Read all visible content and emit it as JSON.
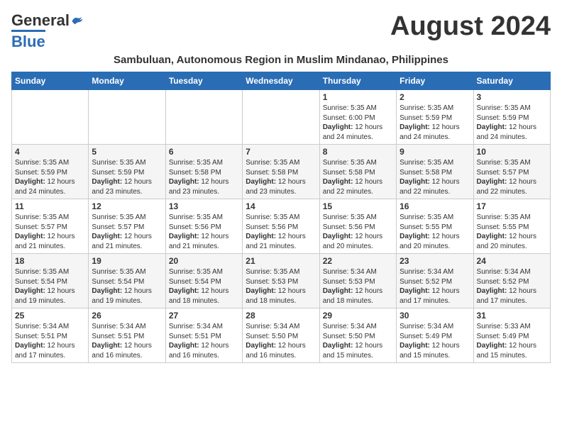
{
  "logo": {
    "general": "General",
    "blue": "Blue"
  },
  "month_year": "August 2024",
  "subtitle": "Sambuluan, Autonomous Region in Muslim Mindanao, Philippines",
  "days_of_week": [
    "Sunday",
    "Monday",
    "Tuesday",
    "Wednesday",
    "Thursday",
    "Friday",
    "Saturday"
  ],
  "weeks": [
    [
      {
        "day": "",
        "sunrise": "",
        "sunset": "",
        "daylight": ""
      },
      {
        "day": "",
        "sunrise": "",
        "sunset": "",
        "daylight": ""
      },
      {
        "day": "",
        "sunrise": "",
        "sunset": "",
        "daylight": ""
      },
      {
        "day": "",
        "sunrise": "",
        "sunset": "",
        "daylight": ""
      },
      {
        "day": "1",
        "sunrise": "Sunrise: 5:35 AM",
        "sunset": "Sunset: 6:00 PM",
        "daylight": "Daylight: 12 hours and 24 minutes."
      },
      {
        "day": "2",
        "sunrise": "Sunrise: 5:35 AM",
        "sunset": "Sunset: 5:59 PM",
        "daylight": "Daylight: 12 hours and 24 minutes."
      },
      {
        "day": "3",
        "sunrise": "Sunrise: 5:35 AM",
        "sunset": "Sunset: 5:59 PM",
        "daylight": "Daylight: 12 hours and 24 minutes."
      }
    ],
    [
      {
        "day": "4",
        "sunrise": "Sunrise: 5:35 AM",
        "sunset": "Sunset: 5:59 PM",
        "daylight": "Daylight: 12 hours and 24 minutes."
      },
      {
        "day": "5",
        "sunrise": "Sunrise: 5:35 AM",
        "sunset": "Sunset: 5:59 PM",
        "daylight": "Daylight: 12 hours and 23 minutes."
      },
      {
        "day": "6",
        "sunrise": "Sunrise: 5:35 AM",
        "sunset": "Sunset: 5:58 PM",
        "daylight": "Daylight: 12 hours and 23 minutes."
      },
      {
        "day": "7",
        "sunrise": "Sunrise: 5:35 AM",
        "sunset": "Sunset: 5:58 PM",
        "daylight": "Daylight: 12 hours and 23 minutes."
      },
      {
        "day": "8",
        "sunrise": "Sunrise: 5:35 AM",
        "sunset": "Sunset: 5:58 PM",
        "daylight": "Daylight: 12 hours and 22 minutes."
      },
      {
        "day": "9",
        "sunrise": "Sunrise: 5:35 AM",
        "sunset": "Sunset: 5:58 PM",
        "daylight": "Daylight: 12 hours and 22 minutes."
      },
      {
        "day": "10",
        "sunrise": "Sunrise: 5:35 AM",
        "sunset": "Sunset: 5:57 PM",
        "daylight": "Daylight: 12 hours and 22 minutes."
      }
    ],
    [
      {
        "day": "11",
        "sunrise": "Sunrise: 5:35 AM",
        "sunset": "Sunset: 5:57 PM",
        "daylight": "Daylight: 12 hours and 21 minutes."
      },
      {
        "day": "12",
        "sunrise": "Sunrise: 5:35 AM",
        "sunset": "Sunset: 5:57 PM",
        "daylight": "Daylight: 12 hours and 21 minutes."
      },
      {
        "day": "13",
        "sunrise": "Sunrise: 5:35 AM",
        "sunset": "Sunset: 5:56 PM",
        "daylight": "Daylight: 12 hours and 21 minutes."
      },
      {
        "day": "14",
        "sunrise": "Sunrise: 5:35 AM",
        "sunset": "Sunset: 5:56 PM",
        "daylight": "Daylight: 12 hours and 21 minutes."
      },
      {
        "day": "15",
        "sunrise": "Sunrise: 5:35 AM",
        "sunset": "Sunset: 5:56 PM",
        "daylight": "Daylight: 12 hours and 20 minutes."
      },
      {
        "day": "16",
        "sunrise": "Sunrise: 5:35 AM",
        "sunset": "Sunset: 5:55 PM",
        "daylight": "Daylight: 12 hours and 20 minutes."
      },
      {
        "day": "17",
        "sunrise": "Sunrise: 5:35 AM",
        "sunset": "Sunset: 5:55 PM",
        "daylight": "Daylight: 12 hours and 20 minutes."
      }
    ],
    [
      {
        "day": "18",
        "sunrise": "Sunrise: 5:35 AM",
        "sunset": "Sunset: 5:54 PM",
        "daylight": "Daylight: 12 hours and 19 minutes."
      },
      {
        "day": "19",
        "sunrise": "Sunrise: 5:35 AM",
        "sunset": "Sunset: 5:54 PM",
        "daylight": "Daylight: 12 hours and 19 minutes."
      },
      {
        "day": "20",
        "sunrise": "Sunrise: 5:35 AM",
        "sunset": "Sunset: 5:54 PM",
        "daylight": "Daylight: 12 hours and 18 minutes."
      },
      {
        "day": "21",
        "sunrise": "Sunrise: 5:35 AM",
        "sunset": "Sunset: 5:53 PM",
        "daylight": "Daylight: 12 hours and 18 minutes."
      },
      {
        "day": "22",
        "sunrise": "Sunrise: 5:34 AM",
        "sunset": "Sunset: 5:53 PM",
        "daylight": "Daylight: 12 hours and 18 minutes."
      },
      {
        "day": "23",
        "sunrise": "Sunrise: 5:34 AM",
        "sunset": "Sunset: 5:52 PM",
        "daylight": "Daylight: 12 hours and 17 minutes."
      },
      {
        "day": "24",
        "sunrise": "Sunrise: 5:34 AM",
        "sunset": "Sunset: 5:52 PM",
        "daylight": "Daylight: 12 hours and 17 minutes."
      }
    ],
    [
      {
        "day": "25",
        "sunrise": "Sunrise: 5:34 AM",
        "sunset": "Sunset: 5:51 PM",
        "daylight": "Daylight: 12 hours and 17 minutes."
      },
      {
        "day": "26",
        "sunrise": "Sunrise: 5:34 AM",
        "sunset": "Sunset: 5:51 PM",
        "daylight": "Daylight: 12 hours and 16 minutes."
      },
      {
        "day": "27",
        "sunrise": "Sunrise: 5:34 AM",
        "sunset": "Sunset: 5:51 PM",
        "daylight": "Daylight: 12 hours and 16 minutes."
      },
      {
        "day": "28",
        "sunrise": "Sunrise: 5:34 AM",
        "sunset": "Sunset: 5:50 PM",
        "daylight": "Daylight: 12 hours and 16 minutes."
      },
      {
        "day": "29",
        "sunrise": "Sunrise: 5:34 AM",
        "sunset": "Sunset: 5:50 PM",
        "daylight": "Daylight: 12 hours and 15 minutes."
      },
      {
        "day": "30",
        "sunrise": "Sunrise: 5:34 AM",
        "sunset": "Sunset: 5:49 PM",
        "daylight": "Daylight: 12 hours and 15 minutes."
      },
      {
        "day": "31",
        "sunrise": "Sunrise: 5:33 AM",
        "sunset": "Sunset: 5:49 PM",
        "daylight": "Daylight: 12 hours and 15 minutes."
      }
    ]
  ]
}
